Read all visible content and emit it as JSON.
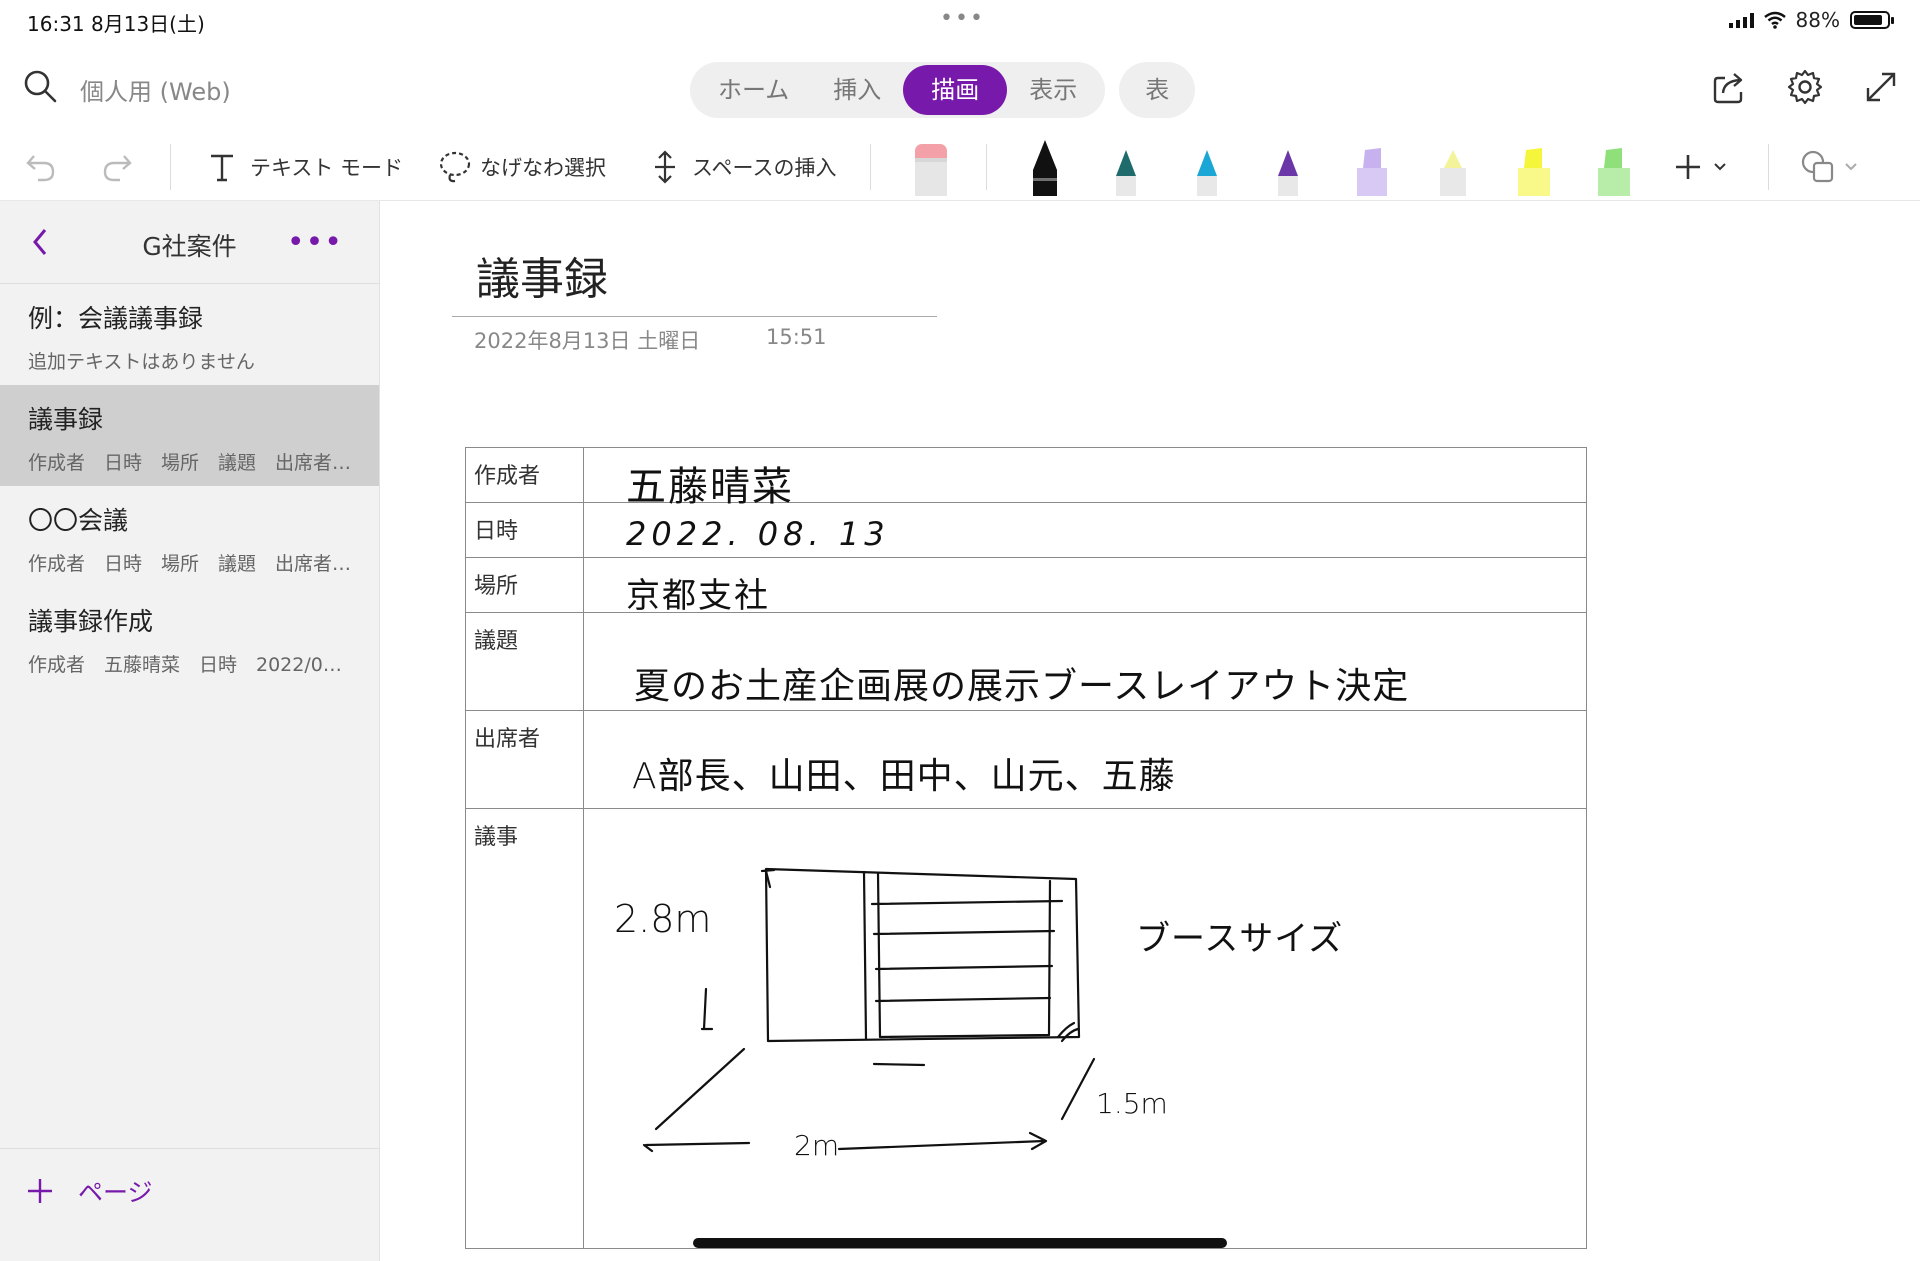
{
  "status": {
    "time": "16:31 8月13日(土)",
    "dots": "•••",
    "battery": "88%"
  },
  "search": {
    "placeholder": "個人用 (Web)"
  },
  "tabs": [
    "ホーム",
    "挿入",
    "描画",
    "表示"
  ],
  "tab_single": "表",
  "toolbar": {
    "text_mode": "テキスト モード",
    "lasso": "なげなわ選択",
    "insert_space": "スペースの挿入"
  },
  "pens": [
    {
      "name": "eraser",
      "color": "#f4a0a8"
    },
    {
      "name": "pen-black",
      "color": "#111111"
    },
    {
      "name": "pen-teal",
      "color": "#1f6b6b"
    },
    {
      "name": "pen-cyan",
      "color": "#1aa7d6"
    },
    {
      "name": "pen-purple",
      "color": "#6a36a8"
    },
    {
      "name": "highlighter-lavender",
      "color": "#c7b2ef"
    },
    {
      "name": "highlighter-lightyellow",
      "color": "#f3f39a"
    },
    {
      "name": "highlighter-yellow",
      "color": "#f5f53b"
    },
    {
      "name": "highlighter-green",
      "color": "#8fe07a"
    }
  ],
  "sidebar": {
    "title": "G社案件",
    "more": "•••",
    "pages": [
      {
        "title": "例：会議議事録",
        "sub": "追加テキストはありません"
      },
      {
        "title": "議事録",
        "sub": "作成者　日時　場所　議題　出席者…"
      },
      {
        "title": "〇〇会議",
        "sub": "作成者　日時　場所　議題　出席者…"
      },
      {
        "title": "議事録作成",
        "sub": "作成者　五藤晴菜　日時　2022/0…"
      }
    ],
    "add_page": "ページ"
  },
  "note": {
    "title": "議事録",
    "date": "2022年8月13日 土曜日",
    "time": "15:51",
    "rows": [
      {
        "label": "作成者",
        "value": "五藤晴菜"
      },
      {
        "label": "日時",
        "value": "2022. 08. 13"
      },
      {
        "label": "場所",
        "value": "京都支社"
      },
      {
        "label": "議題",
        "value": "夏のお土産企画展の展示ブースレイアウト決定"
      },
      {
        "label": "出席者",
        "value": "A部長、山田、田中、山元、五藤"
      },
      {
        "label": "議事",
        "value": ""
      }
    ],
    "sketch": {
      "height": "2.8m",
      "label": "ブースサイズ",
      "depth": "1.5m",
      "width": "2m"
    }
  },
  "colors": {
    "accent": "#7719aa"
  }
}
